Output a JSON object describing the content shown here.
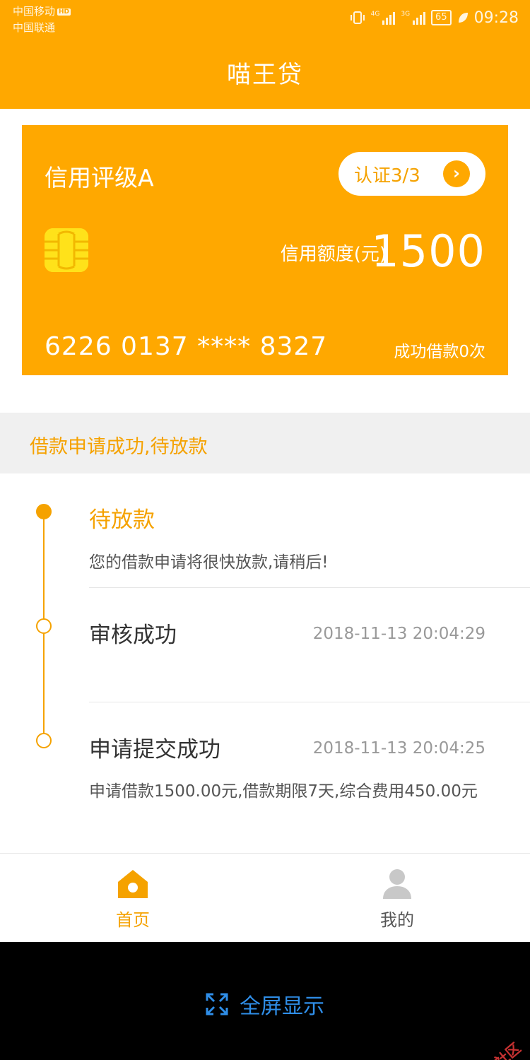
{
  "status_bar": {
    "carrier_1": "中国移动",
    "carrier_1_badge": "HD",
    "carrier_2": "中国联通",
    "network_1": "4G",
    "network_2": "3G",
    "battery": "65",
    "time": "09:28"
  },
  "header": {
    "title": "喵王贷"
  },
  "card": {
    "rating": "信用评级A",
    "verify_label": "认证3/3",
    "limit_label": "信用额度(元)",
    "limit_value": "1500",
    "card_number": "6226 0137 **** 8327",
    "success_count": "成功借款0次"
  },
  "loan_status": {
    "text": "借款申请成功,待放款"
  },
  "timeline": [
    {
      "title": "待放款",
      "desc": "您的借款申请将很快放款,请稍后!"
    },
    {
      "title": "审核成功",
      "time": "2018-11-13 20:04:29"
    },
    {
      "title": "申请提交成功",
      "time": "2018-11-13 20:04:25",
      "desc": "申请借款1500.00元,借款期限7天,综合费用450.00元"
    }
  ],
  "nav": {
    "home_label": "首页",
    "mine_label": "我的"
  },
  "system": {
    "fullscreen_label": "全屏显示",
    "watermark": "卡农社区"
  },
  "colors": {
    "accent": "#ffa800",
    "accent_text": "#f5a200",
    "chip": "#ffe21a",
    "link_blue": "#2f8ee8"
  },
  "icons": {
    "chip": "sim-chip-icon",
    "verify_arrow": "chevron-right-icon",
    "home": "home-icon",
    "mine": "user-icon",
    "fullscreen": "expand-icon"
  }
}
